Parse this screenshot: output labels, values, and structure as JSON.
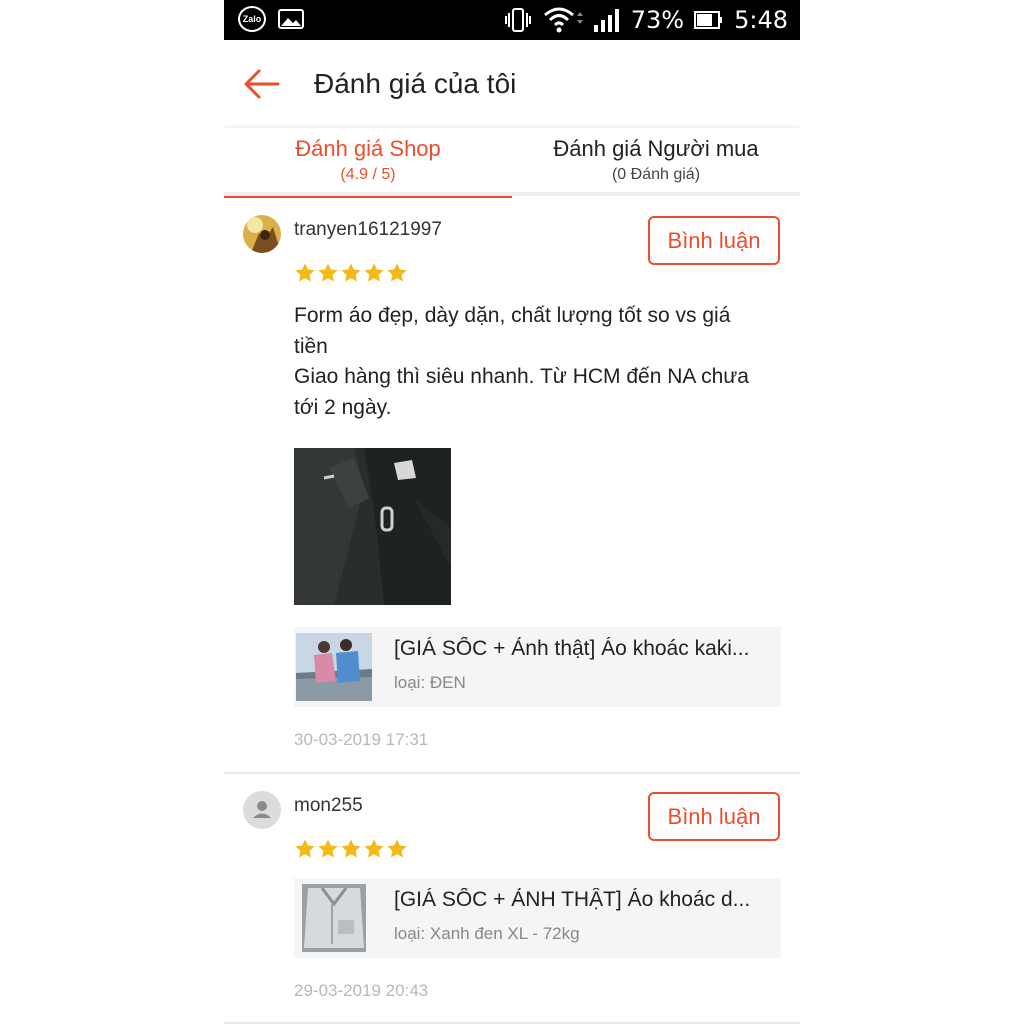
{
  "status_bar": {
    "app_icon": "zalo-icon",
    "zalo_label": "Zalo",
    "battery": "73%",
    "time": "5:48"
  },
  "header": {
    "title": "Đánh giá của tôi"
  },
  "tabs": [
    {
      "label": "Đánh giá Shop",
      "sub": "(4.9 / 5)",
      "active": true
    },
    {
      "label": "Đánh giá Người mua",
      "sub": "(0 Đánh giá)",
      "active": false
    }
  ],
  "reviews": [
    {
      "username": "tranyen16121997",
      "rating": 5,
      "comment_label": "Bình luận",
      "text_lines": [
        "Form áo đẹp, dày dặn, chất lượng tốt so vs giá",
        "tiền",
        "Giao hàng thì siêu nhanh. Từ HCM đến NA chưa",
        "tới 2 ngày."
      ],
      "product_name": "[GIÁ SỐC + Ảnh thật] Áo khoác kaki...",
      "product_variant": "loại: ĐEN",
      "date": "30-03-2019 17:31"
    },
    {
      "username": "mon255",
      "rating": 5,
      "comment_label": "Bình luận",
      "product_name": "[GIÁ SỐC + ẢNH THẬT] Áo khoác d...",
      "product_variant": "loại: Xanh đen XL - 72kg",
      "date": "29-03-2019 20:43"
    }
  ],
  "colors": {
    "accent": "#ee4d2d",
    "star": "#f6b817"
  }
}
